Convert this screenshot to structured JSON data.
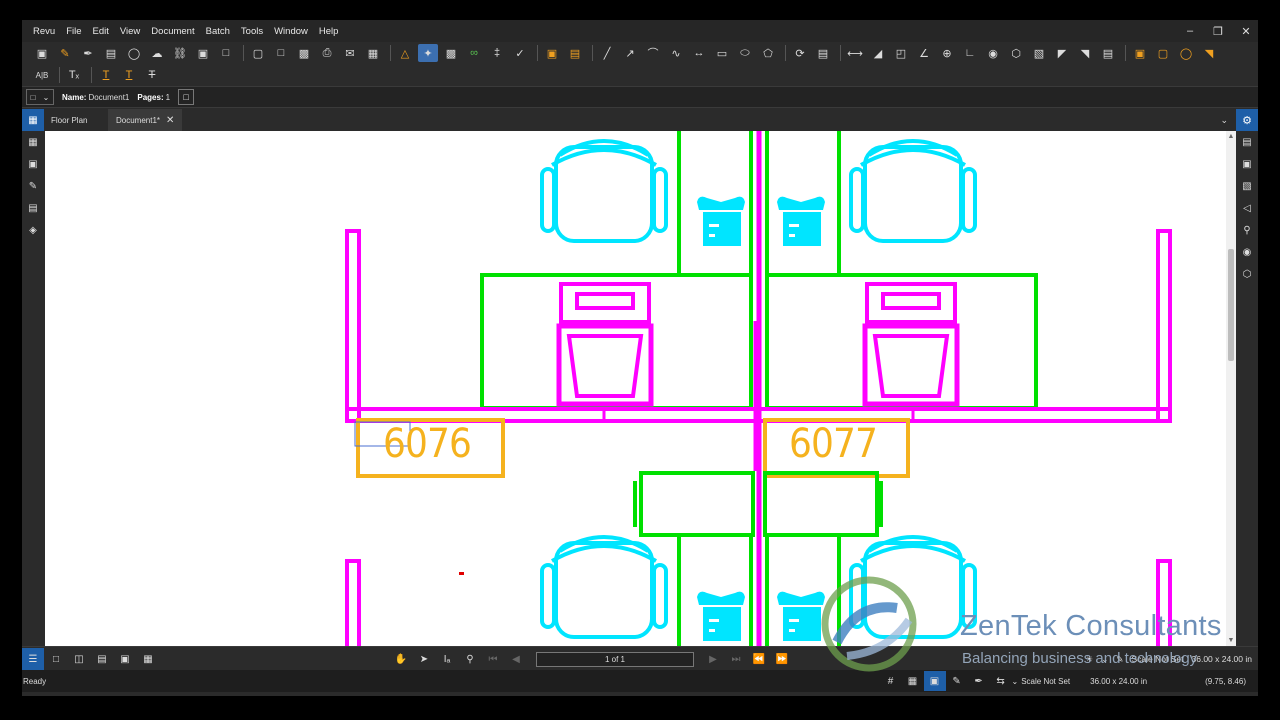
{
  "menu": [
    "Revu",
    "File",
    "Edit",
    "View",
    "Document",
    "Batch",
    "Tools",
    "Window",
    "Help"
  ],
  "window_controls": [
    "minimize",
    "restore",
    "close"
  ],
  "toolbar1_icons": [
    "text-box-icon",
    "highlight-icon",
    "pen-icon",
    "callout-icon",
    "shape-icon",
    "cloud-icon",
    "stamp-icon",
    "image-icon",
    "crop-icon",
    "new-icon",
    "open-icon",
    "save-icon",
    "print-icon",
    "email-icon",
    "markup-list-icon",
    "bell-icon",
    "select-icon",
    "snapshot-icon",
    "link-icon",
    "attach-icon",
    "eraser-icon",
    "overlay-icon",
    "compare-icon",
    "line-icon",
    "arrow-icon",
    "arc-icon",
    "polyline-icon",
    "dimension-icon",
    "rectangle-icon",
    "ellipse-icon",
    "polygon-icon",
    "rotate-icon",
    "split-icon",
    "length-icon",
    "area-icon",
    "perimeter-icon",
    "angle-icon",
    "radius-icon",
    "count-icon",
    "volume-icon",
    "diameter-icon",
    "calibrate-icon",
    "cutout-icon",
    "polylength-icon",
    "wall-icon",
    "dynamic-fill-icon",
    "space-icon",
    "space-edit-icon",
    "space-circle-icon",
    "space-flip-icon"
  ],
  "toolbar2_icons": [
    "spellcheck-icon",
    "text-format-icon",
    "underline-text-icon",
    "bold-text-icon",
    "strikethrough-text-icon"
  ],
  "properties": {
    "name_label": "Name:",
    "name_value": "Document1",
    "pages_label": "Pages:",
    "pages_value": "1"
  },
  "tabs": [
    {
      "label": "Floor Plan",
      "active": false
    },
    {
      "label": "Document1*",
      "active": true
    }
  ],
  "left_rail_icons": [
    "thumbnails-icon",
    "bookmarks-icon",
    "signatures-icon",
    "toolchest-icon",
    "layers-icon"
  ],
  "right_rail_icons": [
    "properties-icon",
    "measure-icon",
    "markups-icon",
    "stamp-panel-icon",
    "tag-icon",
    "search-icon",
    "location-icon",
    "link-panel-icon"
  ],
  "floorplan": {
    "rooms": [
      "6076",
      "6077"
    ],
    "colors": {
      "partition": "#ff00ff",
      "desk": "#00ff00",
      "chair": "#00ffff",
      "label": "#f5b21e"
    }
  },
  "watermark": {
    "title": "ZenTek Consultants",
    "tagline": "Balancing business and technology"
  },
  "navigation": {
    "page_indicator": "1 of 1",
    "scale": "Scale Not Set",
    "page_size": "36.00 x 24.00 in"
  },
  "status": {
    "ready": "Ready",
    "scale": "Scale Not Set",
    "page_size": "36.00 x 24.00 in",
    "cursor": "(9.75, 8.46)"
  },
  "accent_color": "#1e5fa8"
}
